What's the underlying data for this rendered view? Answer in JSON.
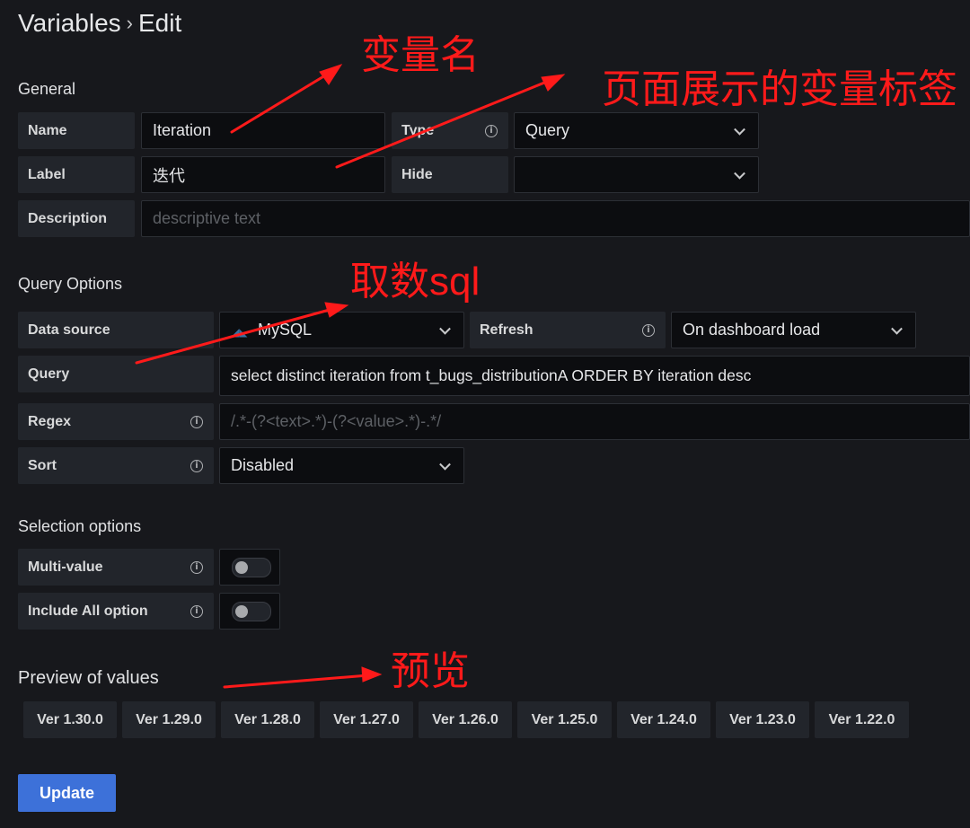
{
  "header": {
    "crumb1": "Variables",
    "sep": "›",
    "crumb2": "Edit"
  },
  "general": {
    "section_title": "General",
    "name_label": "Name",
    "name_value": "Iteration",
    "type_label": "Type",
    "type_value": "Query",
    "label_label": "Label",
    "label_value": "迭代",
    "hide_label": "Hide",
    "hide_value": "",
    "description_label": "Description",
    "description_placeholder": "descriptive text"
  },
  "query_options": {
    "section_title": "Query Options",
    "datasource_label": "Data source",
    "datasource_value": "MySQL",
    "refresh_label": "Refresh",
    "refresh_value": "On dashboard load",
    "query_label": "Query",
    "query_value": "select distinct iteration from t_bugs_distributionA ORDER BY iteration desc",
    "regex_label": "Regex",
    "regex_placeholder": "/.*-(?<text>.*)-(?<value>.*)-.*/",
    "sort_label": "Sort",
    "sort_value": "Disabled"
  },
  "selection_options": {
    "section_title": "Selection options",
    "multi_label": "Multi-value",
    "include_all_label": "Include All option"
  },
  "preview": {
    "section_title": "Preview of values",
    "values": [
      "Ver 1.30.0",
      "Ver 1.29.0",
      "Ver 1.28.0",
      "Ver 1.27.0",
      "Ver 1.26.0",
      "Ver 1.25.0",
      "Ver 1.24.0",
      "Ver 1.23.0",
      "Ver 1.22.0"
    ]
  },
  "actions": {
    "update_label": "Update"
  },
  "annotations": {
    "var_name": "变量名",
    "page_label": "页面展示的变量标签",
    "fetch_sql": "取数sql",
    "preview": "预览"
  },
  "colors": {
    "background": "#17181c",
    "accent": "#3d71d9",
    "annotation": "#ff1a1a"
  },
  "icons": [
    "info-icon",
    "chevron-down-icon",
    "database-icon",
    "toggle-switch"
  ]
}
